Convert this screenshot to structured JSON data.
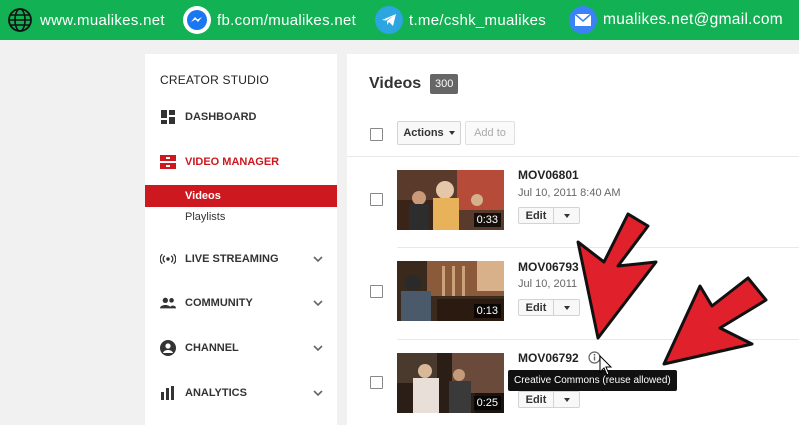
{
  "banner": {
    "website": "www.mualikes.net",
    "facebook": "fb.com/mualikes.net",
    "telegram": "t.me/cshk_mualikes",
    "email": "mualikes.net@gmail.com",
    "color": "#12b254"
  },
  "sidebar": {
    "title": "CREATOR STUDIO",
    "items": [
      {
        "label": "DASHBOARD",
        "icon": "dashboard-icon"
      },
      {
        "label": "VIDEO MANAGER",
        "icon": "video-manager-icon"
      },
      {
        "label": "LIVE STREAMING",
        "icon": "live-streaming-icon"
      },
      {
        "label": "COMMUNITY",
        "icon": "community-icon"
      },
      {
        "label": "CHANNEL",
        "icon": "channel-icon"
      },
      {
        "label": "ANALYTICS",
        "icon": "analytics-icon"
      }
    ],
    "subitems": [
      {
        "label": "Videos",
        "active": true
      },
      {
        "label": "Playlists",
        "active": false
      }
    ],
    "accent": "#cc181e"
  },
  "main": {
    "title": "Videos",
    "count": "300",
    "actions_label": "Actions",
    "add_to_label": "Add to",
    "videos": [
      {
        "title": "MOV06801",
        "date": "Jul 10, 2011 8:40 AM",
        "duration": "0:33",
        "edit_label": "Edit"
      },
      {
        "title": "MOV06793",
        "date": "Jul 10, 2011",
        "duration": "0:13",
        "edit_label": "Edit"
      },
      {
        "title": "MOV06792",
        "date": "",
        "duration": "0:25",
        "edit_label": "Edit"
      }
    ]
  },
  "tooltip": "Creative Commons (reuse allowed)"
}
